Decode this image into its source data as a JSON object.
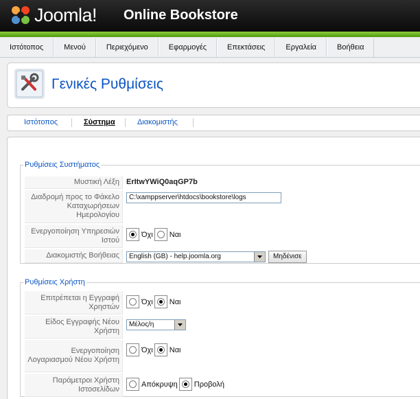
{
  "header": {
    "logo_text": "Joomla!",
    "site_title": "Online Bookstore"
  },
  "menu": [
    "Ιστότοπος",
    "Μενού",
    "Περιεχόμενο",
    "Εφαρμογές",
    "Επεκτάσεις",
    "Εργαλεία",
    "Βοήθεια"
  ],
  "page": {
    "title": "Γενικές Ρυθμίσεις"
  },
  "subnav": {
    "items": [
      "Ιστότοπος",
      "Σύστημα",
      "Διακομιστής"
    ],
    "active": "Σύστημα"
  },
  "system_settings": {
    "legend": "Ρυθμίσεις Συστήματος",
    "secret_label": "Μυστική Λέξη",
    "secret_value": "ErItwYWiQ0aqGP7b",
    "log_path_label": "Διαδρομή προς το Φάκελο Καταχωρήσεων Ημερολογίου",
    "log_path_value": "C:\\xamppserver\\htdocs\\bookstore\\logs",
    "web_services_label": "Ενεργοποίηση Υπηρεσιών Ιστού",
    "web_services_no": "Όχι",
    "web_services_yes": "Ναι",
    "web_services_selected": "no",
    "help_server_label": "Διακομιστής Βοήθειας",
    "help_server_value": "English (GB) - help.joomla.org",
    "reset_button": "Μηδένισε"
  },
  "user_settings": {
    "legend": "Ρυθμίσεις Χρήστη",
    "allow_reg_label": "Επιτρέπεται η Εγγραφή Χρηστών",
    "allow_reg_no": "Όχι",
    "allow_reg_yes": "Ναι",
    "allow_reg_selected": "yes",
    "reg_type_label": "Είδος Εγγραφής Νέου Χρήστη",
    "reg_type_value": "Μέλος/η",
    "activation_label": "Ενεργοποίηση Λογαριασμού Νέου Χρήστη",
    "activation_no": "Όχι",
    "activation_yes": "Ναι",
    "activation_selected": "yes",
    "frontend_params_label": "Παράμετροι Χρήστη Ιστοσελίδων",
    "frontend_params_hide": "Απόκρυψη",
    "frontend_params_show": "Προβολή",
    "frontend_params_selected": "show"
  },
  "colors": {
    "accent": "#0b55c4",
    "header_green": "#6db52a"
  }
}
